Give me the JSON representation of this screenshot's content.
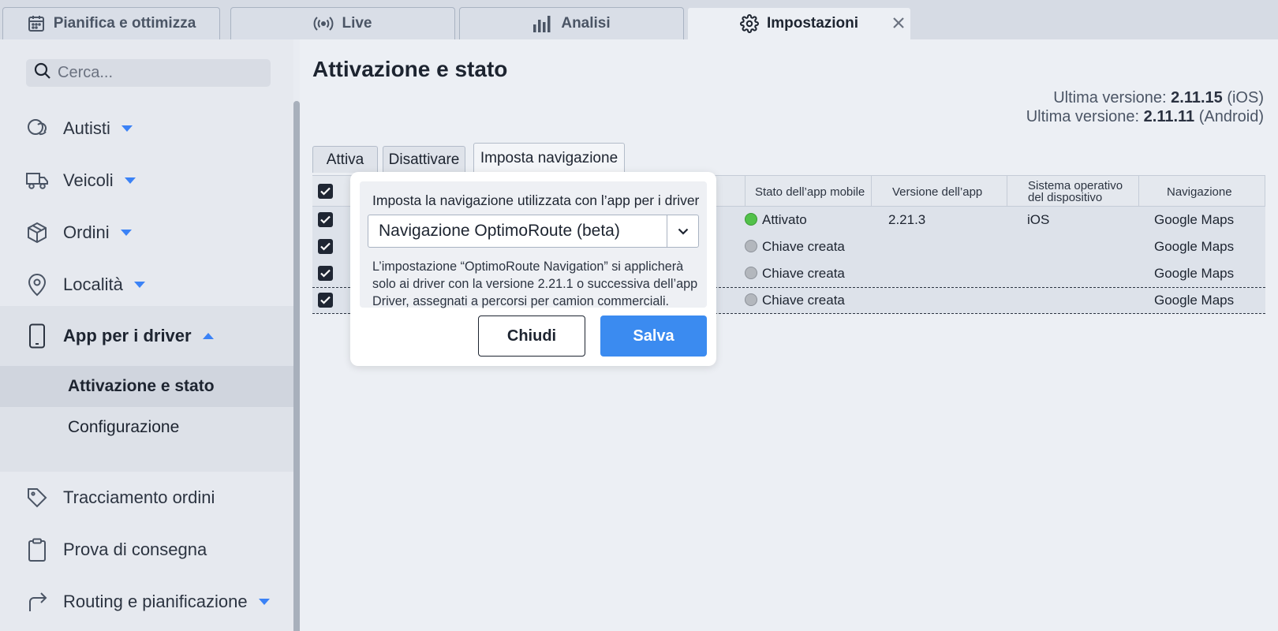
{
  "top_tabs": [
    {
      "label": "Pianifica e ottimizza",
      "icon": "calendar-icon"
    },
    {
      "label": "Live",
      "icon": "broadcast-icon"
    },
    {
      "label": "Analisi",
      "icon": "bar-chart-icon"
    },
    {
      "label": "Impostazioni",
      "icon": "gear-icon",
      "active": true
    }
  ],
  "sidebar": {
    "search_placeholder": "Cerca...",
    "items": [
      {
        "label": "Autisti",
        "icon": "user-icon",
        "caret": "down"
      },
      {
        "label": "Veicoli",
        "icon": "truck-icon",
        "caret": "down"
      },
      {
        "label": "Ordini",
        "icon": "box-icon",
        "caret": "down"
      },
      {
        "label": "Località",
        "icon": "map-pin-icon",
        "caret": "down"
      },
      {
        "label": "App per i driver",
        "icon": "phone-icon",
        "caret": "up"
      },
      {
        "label": "Tracciamento ordini",
        "icon": "tag-icon"
      },
      {
        "label": "Prova di consegna",
        "icon": "clipboard-icon"
      },
      {
        "label": "Routing e pianificazione",
        "icon": "route-arrow-icon",
        "caret": "down"
      }
    ],
    "sub_items": [
      {
        "label": "Attivazione e stato",
        "active": true
      },
      {
        "label": "Configurazione"
      }
    ]
  },
  "main": {
    "title": "Attivazione e stato",
    "version_label": "Ultima versione:",
    "ios_version": "2.11.15",
    "ios_platform": "(iOS)",
    "android_version": "2.11.11",
    "android_platform": "(Android)",
    "subtabs": [
      "Attiva",
      "Disattivare",
      "Imposta navigazione"
    ],
    "columns": [
      "Stato dell’app mobile",
      "Versione dell’app",
      "Sistema operativo del dispositivo",
      "Navigazione"
    ],
    "rows": [
      {
        "status": "Attivato",
        "status_color": "#52c14a",
        "version": "2.21.3",
        "os": "iOS",
        "nav": "Google Maps",
        "trunc": ""
      },
      {
        "status": "Chiave creata",
        "status_color": "#b3b7bd",
        "version": "",
        "os": "",
        "nav": "Google Maps",
        "trunc": "..."
      },
      {
        "status": "Chiave creata",
        "status_color": "#b3b7bd",
        "version": "",
        "os": "",
        "nav": "Google Maps",
        "trunc": "..."
      },
      {
        "status": "Chiave creata",
        "status_color": "#b3b7bd",
        "version": "",
        "os": "",
        "nav": "Google Maps",
        "trunc": "..."
      }
    ]
  },
  "modal": {
    "label": "Imposta la navigazione utilizzata con l’app per i driver",
    "select_value": "Navigazione OptimoRoute (beta)",
    "note": "L’impostazione “OptimoRoute Navigation” si applicherà solo ai driver con la versione 2.21.1 o successiva dell’app Driver, assegnati a percorsi per camion commerciali.",
    "close_label": "Chiudi",
    "save_label": "Salva",
    "save_color": "#3b8bf0"
  }
}
